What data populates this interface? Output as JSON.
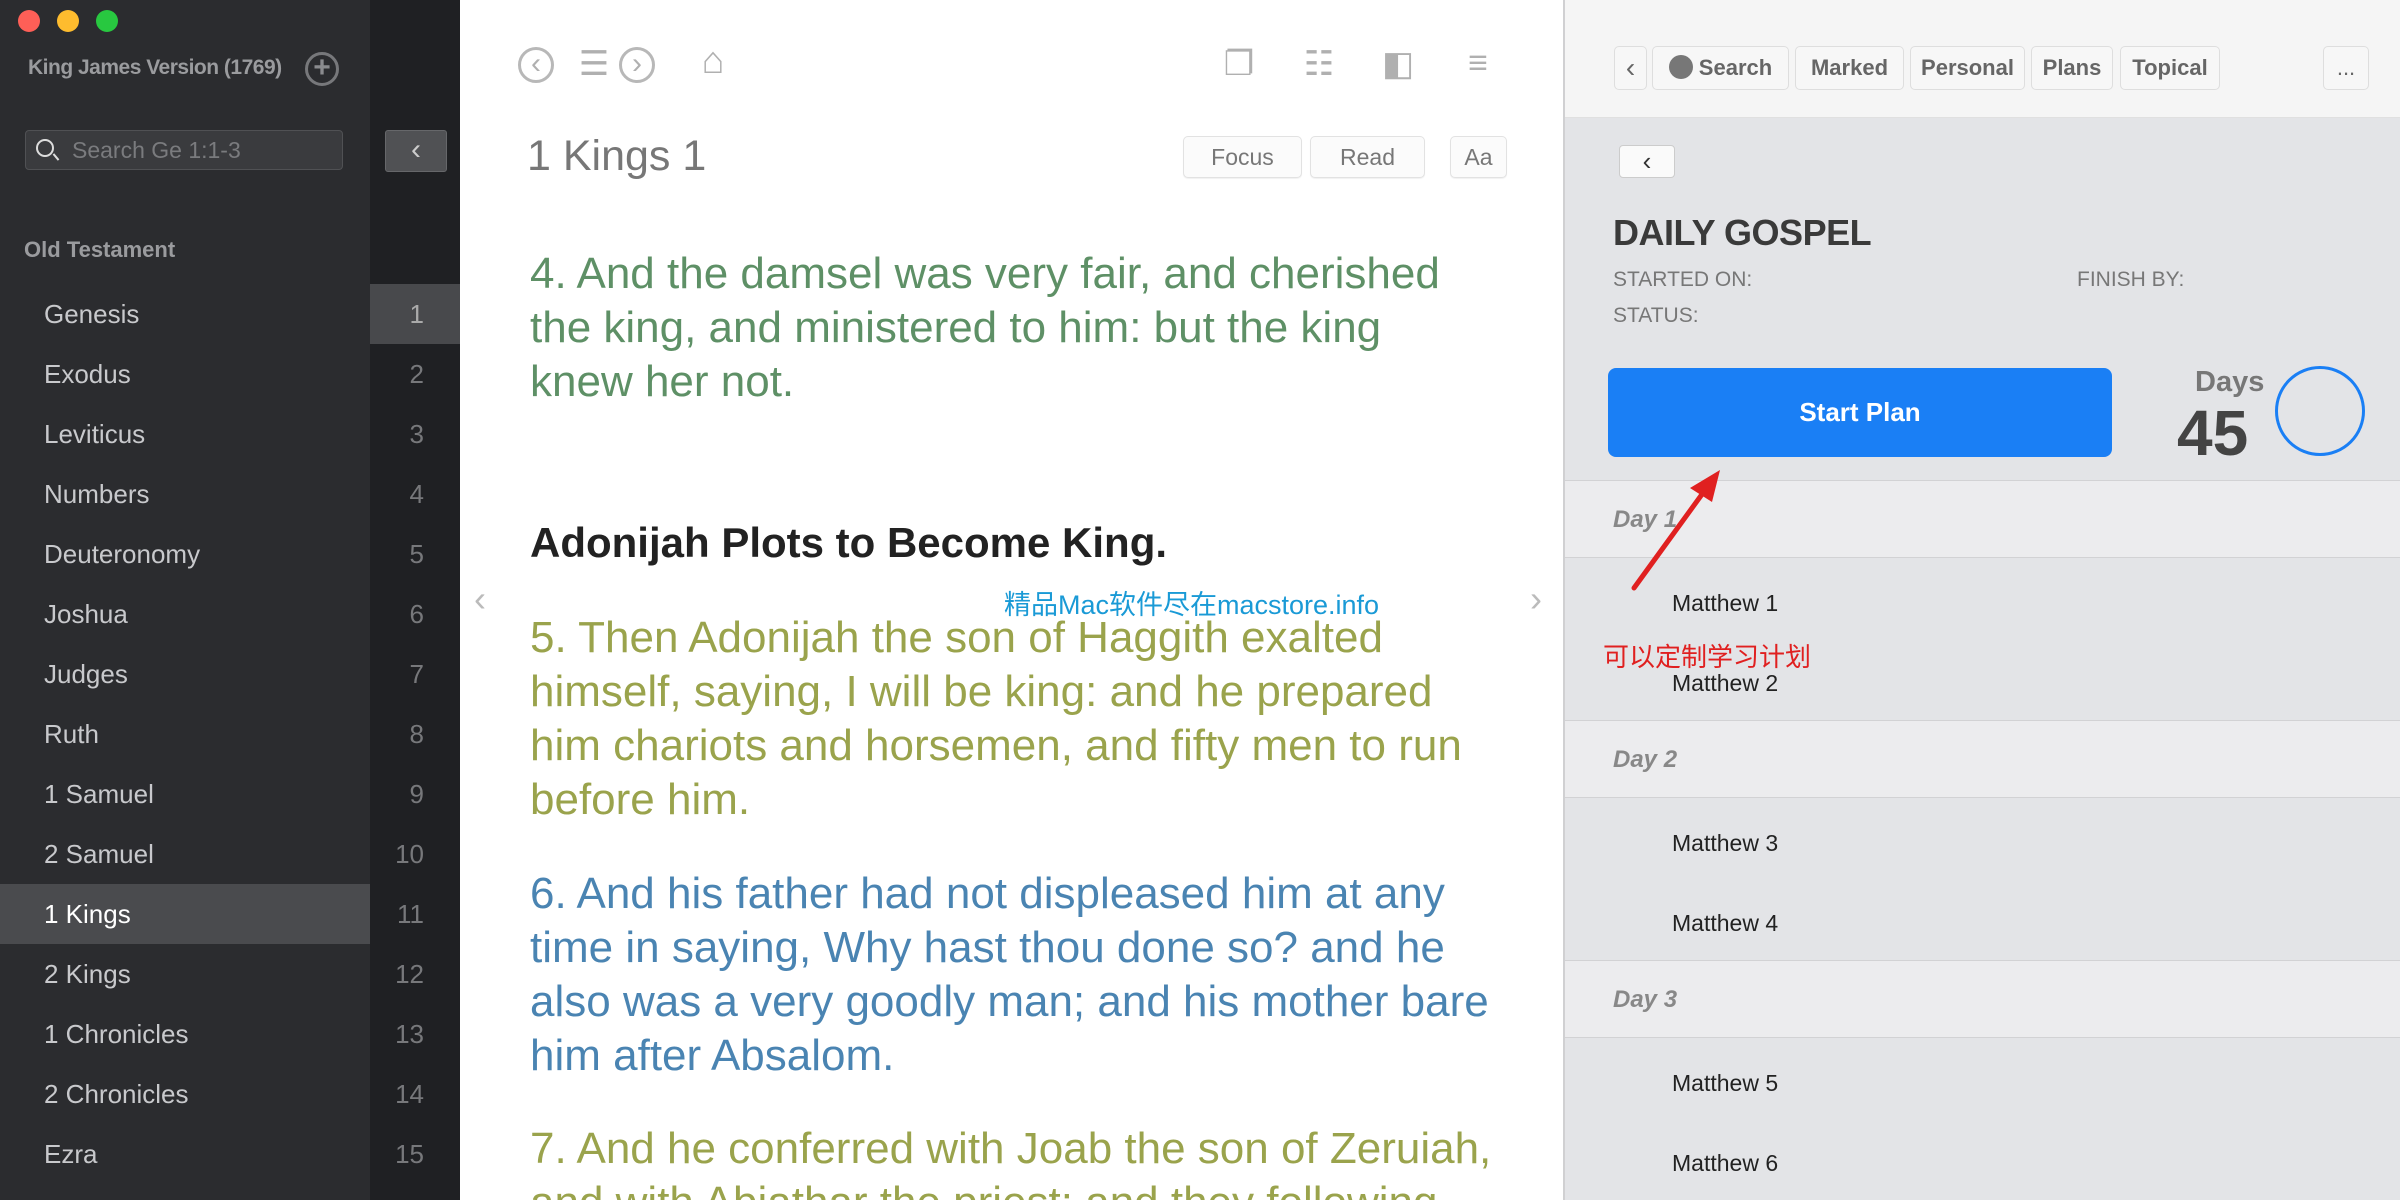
{
  "window": {
    "controls": [
      "close",
      "minimize",
      "zoom"
    ],
    "colors": {
      "close": "#fe5f57",
      "minimize": "#febc2e",
      "zoom": "#28c840"
    }
  },
  "sidebar": {
    "bible_title": "King James Version (1769)",
    "add_icon": "+",
    "search_placeholder": "Search Ge 1:1-3",
    "collapse_icon": "‹",
    "section": "Old Testament",
    "books": [
      {
        "name": "Genesis",
        "num": "1"
      },
      {
        "name": "Exodus",
        "num": "2"
      },
      {
        "name": "Leviticus",
        "num": "3"
      },
      {
        "name": "Numbers",
        "num": "4"
      },
      {
        "name": "Deuteronomy",
        "num": "5"
      },
      {
        "name": "Joshua",
        "num": "6"
      },
      {
        "name": "Judges",
        "num": "7"
      },
      {
        "name": "Ruth",
        "num": "8"
      },
      {
        "name": "1 Samuel",
        "num": "9"
      },
      {
        "name": "2 Samuel",
        "num": "10"
      },
      {
        "name": "1 Kings",
        "num": "11"
      },
      {
        "name": "2 Kings",
        "num": "12"
      },
      {
        "name": "1 Chronicles",
        "num": "13"
      },
      {
        "name": "2 Chronicles",
        "num": "14"
      },
      {
        "name": "Ezra",
        "num": "15"
      }
    ],
    "selected_book": "1 Kings",
    "selected_chapter": "1"
  },
  "toolbar": {
    "icons": [
      "back-circle-icon",
      "list-icon",
      "forward-circle-icon",
      "home-icon",
      "copy-icon",
      "presentation-icon",
      "split-view-icon",
      "outline-icon"
    ]
  },
  "reader": {
    "chapter_title": "1 Kings 1",
    "focus": "Focus",
    "read": "Read",
    "font": "Aa",
    "verse4": [
      "4. And the damsel was very fair, and cherished",
      "the king, and ministered to him: but the king",
      "knew her not."
    ],
    "heading": "Adonijah Plots to Become King.",
    "verse5": [
      "5. Then Adonijah the son of Haggith exalted",
      "himself, saying, I will be king: and he prepared",
      "him chariots and horsemen, and fifty men to run",
      "before him."
    ],
    "verse6": [
      "6. And his father had not displeased him at any",
      "time in saying, Why hast thou done so? and he",
      "also was a very goodly man; and his mother bare",
      "him after Absalom."
    ],
    "verse7": [
      "7. And he conferred with Joab the son of Zeruiah,",
      "and with Abiathar the priest: and they following"
    ],
    "colors": {
      "verse4": "#5e9066",
      "verse5": "#9aa34c",
      "verse6": "#4a84b2",
      "verse7": "#9aa34c"
    },
    "watermark": "精品Mac软件尽在macstore.info",
    "prev": "‹",
    "next": "›"
  },
  "panel": {
    "tabs": [
      "Search",
      "Marked",
      "Personal",
      "Plans",
      "Topical"
    ],
    "more": "...",
    "plan_title": "DAILY GOSPEL",
    "started_on": "STARTED ON:",
    "finish_by": "FINISH BY:",
    "status": "STATUS:",
    "start_button": "Start Plan",
    "days_label": "Days",
    "days": "45",
    "progress": 0,
    "accent": "#1a7ff5",
    "schedule": [
      {
        "day": "Day 1",
        "items": [
          "Matthew 1",
          "Matthew 2"
        ]
      },
      {
        "day": "Day 2",
        "items": [
          "Matthew 3",
          "Matthew 4"
        ]
      },
      {
        "day": "Day 3",
        "items": [
          "Matthew 5",
          "Matthew 6"
        ]
      }
    ]
  },
  "annotation": {
    "text": "可以定制学习计划",
    "color": "#e02020"
  }
}
